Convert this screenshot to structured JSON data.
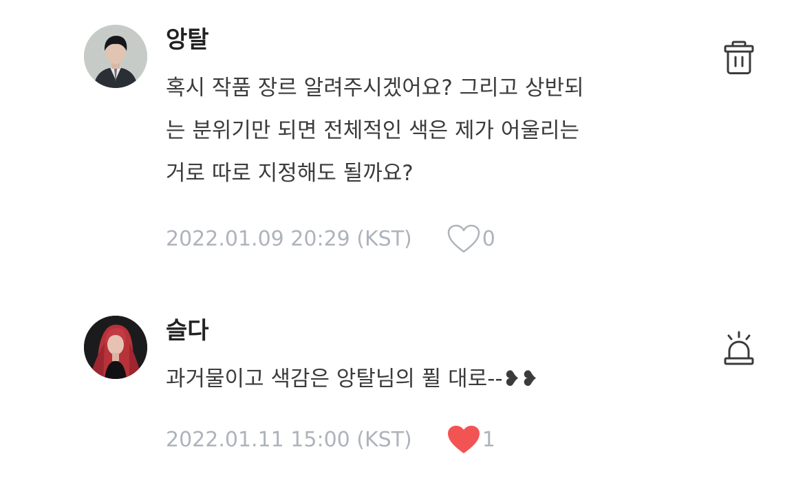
{
  "comments": [
    {
      "author": "앙탈",
      "lines": [
        "혹시 작품 장르 알려주시겠어요? 그리고 상반되",
        "는 분위기만 되면 전체적인 색은 제가 어울리는",
        "거로 따로 지정해도 될까요?"
      ],
      "date": "2022.01.09 20:29 (KST)",
      "likes": "0",
      "liked": false,
      "action_icon": "trash-icon"
    },
    {
      "author": "슬다",
      "lines": [
        "과거물이고 색감은 앙탈님의 퓔 대로--❥❥"
      ],
      "date": "2022.01.11 15:00 (KST)",
      "likes": "1",
      "liked": true,
      "action_icon": "report-siren-icon"
    }
  ],
  "colors": {
    "liked_heart": "#f25454",
    "muted_text": "#aeb3bb",
    "icon_stroke": "#3a3a3a"
  }
}
